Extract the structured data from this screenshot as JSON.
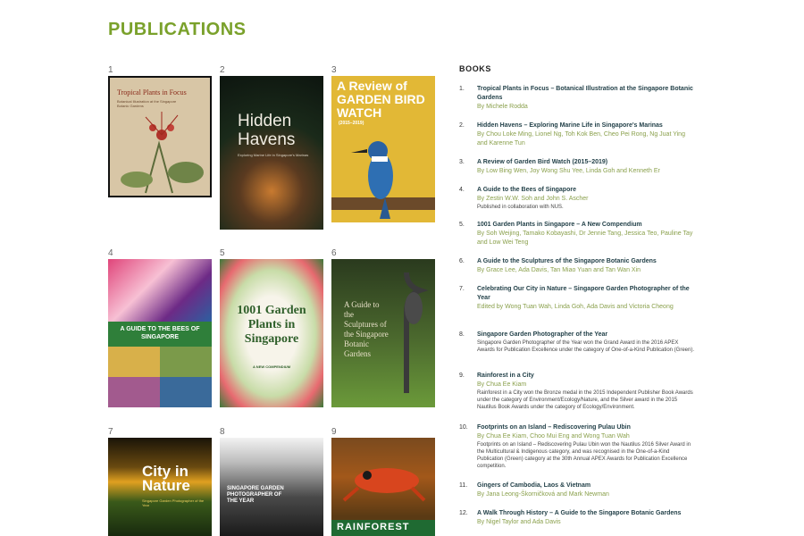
{
  "page": {
    "heading": "PUBLICATIONS"
  },
  "covers": [
    {
      "num": "1",
      "text": "Tropical Plants in Focus",
      "sub": "Botanical Illustration at the Singapore Botanic Gardens"
    },
    {
      "num": "2",
      "text": "Hidden Havens",
      "sub": "Exploring Marine Life in Singapore's Marinas"
    },
    {
      "num": "3",
      "text": "A Review of GARDEN BIRD WATCH",
      "sub": "(2015–2019)"
    },
    {
      "num": "4",
      "text": "A GUIDE TO THE BEES OF SINGAPORE",
      "sub": ""
    },
    {
      "num": "5",
      "text": "1001 Garden Plants in Singapore",
      "sub": "A NEW COMPENDIUM"
    },
    {
      "num": "6",
      "text": "A Guide to the Sculptures of the Singapore Botanic Gardens",
      "sub": ""
    },
    {
      "num": "7",
      "text": "City in Nature",
      "sub": "Singapore Garden Photographer of the Year"
    },
    {
      "num": "8",
      "text": "SINGAPORE GARDEN PHOTOGRAPHER OF THE YEAR",
      "sub": ""
    },
    {
      "num": "9",
      "text": "RAINFOREST",
      "sub": ""
    }
  ],
  "books": {
    "title": "BOOKS",
    "items": [
      {
        "num": "1.",
        "title": "Tropical Plants in Focus – Botanical Illustration at the Singapore Botanic Gardens",
        "author": "By Michele Rodda",
        "desc": ""
      },
      {
        "num": "2.",
        "title": "Hidden Havens – Exploring Marine Life in Singapore's Marinas",
        "author": "By Chou Loke Ming, Lionel Ng, Toh Kok Ben, Cheo Pei Rong, Ng Juat Ying and Karenne Tun",
        "desc": ""
      },
      {
        "num": "3.",
        "title": "A Review of Garden Bird Watch (2015–2019)",
        "author": "By Low Bing Wen, Joy Wong Shu Yee, Linda Goh and Kenneth Er",
        "desc": ""
      },
      {
        "num": "4.",
        "title": "A Guide to the Bees of Singapore",
        "author": "By Zestin W.W. Soh and John S. Ascher",
        "desc": "Published in collaboration with NUS."
      },
      {
        "num": "5.",
        "title": "1001 Garden Plants in Singapore – A New Compendium",
        "author": "By Soh Weijing, Tamako Kobayashi, Dr Jennie Tang, Jessica Teo, Pauline Tay and Low Wei Teng",
        "desc": ""
      },
      {
        "num": "6.",
        "title": "A Guide to the Sculptures of the Singapore Botanic Gardens",
        "author": "By Grace Lee, Ada Davis, Tan Miao Yuan and Tan Wan Xin",
        "desc": ""
      },
      {
        "num": "7.",
        "title": "Celebrating Our City in Nature – Singapore Garden Photographer of the Year",
        "author": "Edited by Wong Tuan Wah, Linda Goh, Ada Davis and Victoria Cheong",
        "desc": ""
      },
      {
        "num": "8.",
        "title": "Singapore Garden Photographer of the Year",
        "author": "",
        "desc": "Singapore Garden Photographer of the Year won the Grand Award in the 2016 APEX Awards for Publication Excellence under the category of One-of-a-Kind Publication (Green)."
      },
      {
        "num": "9.",
        "title": "Rainforest in a City",
        "author": "By Chua Ee Kiam",
        "desc": "Rainforest in a City won the Bronze medal in the 2015 Independent Publisher Book Awards under the category of Environment/Ecology/Nature, and the Silver award in the 2015 Nautilus Book Awards under the category of Ecology/Environment."
      },
      {
        "num": "10.",
        "title": "Footprints on an Island – Rediscovering Pulau Ubin",
        "author": "By Chua Ee Kiam, Choo Mui Eng and Wong Tuan Wah",
        "desc": "Footprints on an Island – Rediscovering Pulau Ubin won the Nautilus 2016 Silver Award in the Multicultural & Indigenous category, and was recognised in the One-of-a-Kind Publication (Green) category at the 30th Annual APEX Awards for Publication Excellence competition."
      },
      {
        "num": "11.",
        "title": "Gingers of Cambodia, Laos & Vietnam",
        "author": "By Jana Leong-Škorničková and Mark Newman",
        "desc": ""
      },
      {
        "num": "12.",
        "title": "A Walk Through History – A Guide to the Singapore Botanic Gardens",
        "author": "By Nigel Taylor and Ada Davis",
        "desc": ""
      }
    ]
  },
  "colors": {
    "accent": "#7aa12b",
    "title": "#24424a",
    "author": "#8aa04c"
  }
}
